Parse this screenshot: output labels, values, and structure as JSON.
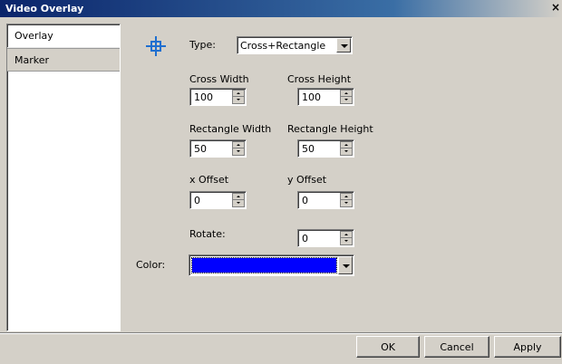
{
  "window": {
    "title": "Video Overlay",
    "close_glyph": "×"
  },
  "sidebar": {
    "items": [
      {
        "label": "Overlay"
      },
      {
        "label": "Marker",
        "selected": true
      }
    ]
  },
  "marker": {
    "icon": "crosshair-rectangle-icon",
    "type_label": "Type:",
    "type_value": "Cross+Rectangle",
    "cross_width_label": "Cross Width",
    "cross_width_value": "100",
    "cross_height_label": "Cross Height",
    "cross_height_value": "100",
    "rect_width_label": "Rectangle Width",
    "rect_width_value": "50",
    "rect_height_label": "Rectangle Height",
    "rect_height_value": "50",
    "x_offset_label": "x Offset",
    "x_offset_value": "0",
    "y_offset_label": "y Offset",
    "y_offset_value": "0",
    "rotate_label": "Rotate:",
    "rotate_value": "0",
    "color_label": "Color:",
    "color_value": "#0000ff"
  },
  "buttons": {
    "ok": "OK",
    "cancel": "Cancel",
    "apply": "Apply"
  },
  "colors": {
    "title_bar": "#0a246a",
    "dialog_bg": "#d4d0c8",
    "accent_icon": "#1f6fd0"
  }
}
